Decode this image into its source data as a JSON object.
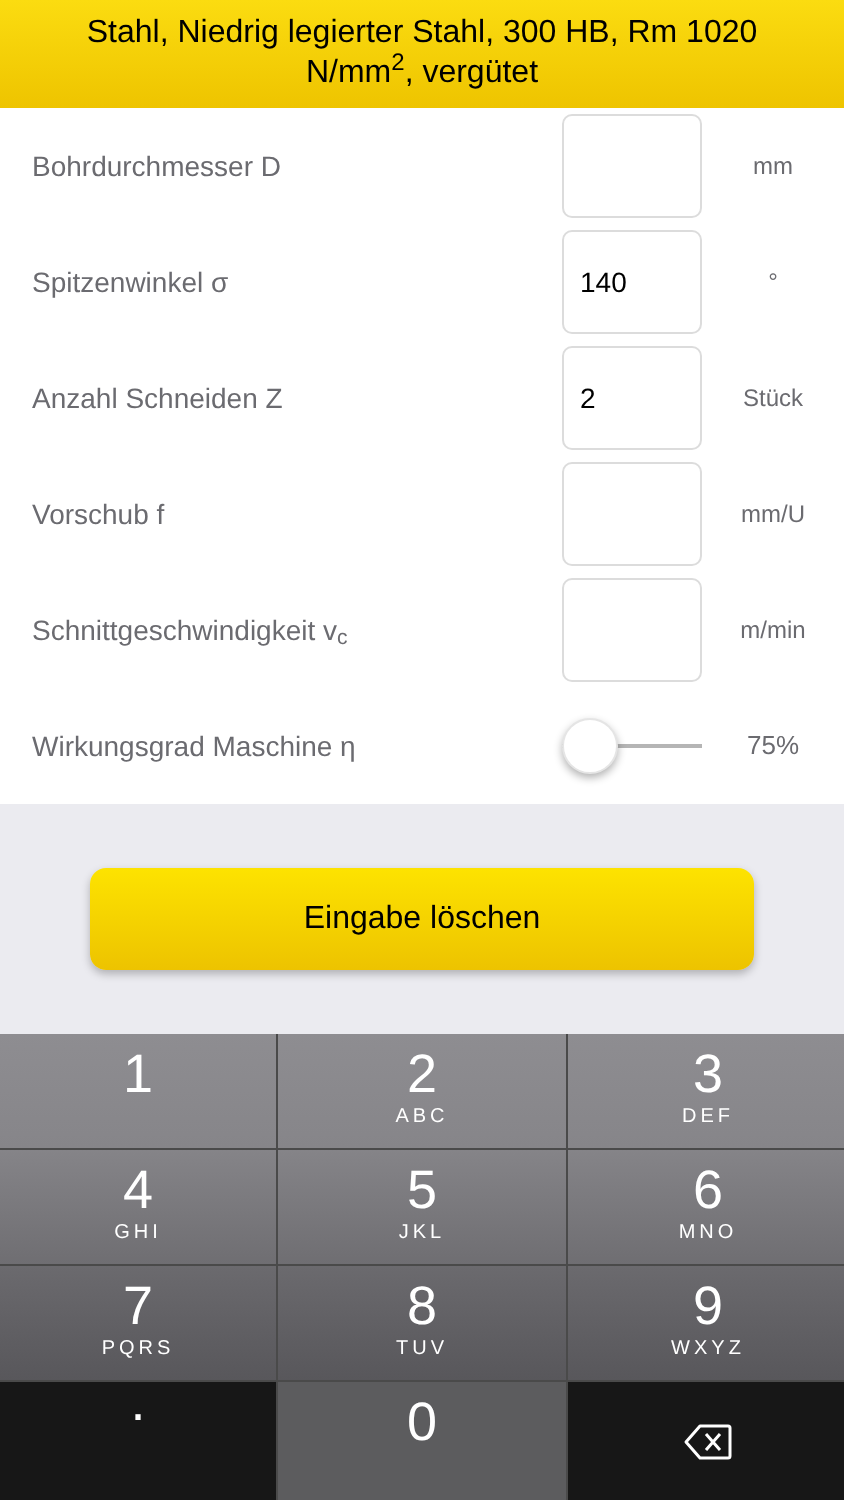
{
  "header": {
    "title": "Stahl, Niedrig legierter Stahl, 300 HB, Rm 1020 N/mm$^{2}$, vergütet"
  },
  "rows": [
    {
      "kind": "input",
      "label": "Bohrdurchmesser D",
      "unit": "mm"
    },
    {
      "kind": "input",
      "label": "Spitzenwinkel σ",
      "value": "140",
      "unit": "°"
    },
    {
      "kind": "input",
      "label": "Anzahl Schneiden Z",
      "value": "2",
      "unit": "Stück"
    },
    {
      "kind": "input",
      "label": "Vorschub f",
      "unit": "mm/U"
    },
    {
      "kind": "input",
      "label": "Schnittgeschwindigkeit v$_{c}$",
      "unit": "m/min"
    },
    {
      "kind": "slider",
      "label": "Wirkungsgrad Maschine η",
      "level": 0,
      "reading": "75%"
    }
  ],
  "clear_button": {
    "label": "Eingabe löschen"
  },
  "keypad": [
    {
      "kind": "digit",
      "digit": "1"
    },
    {
      "kind": "digit",
      "digit": "2",
      "letters": "ABC"
    },
    {
      "kind": "digit",
      "digit": "3",
      "letters": "DEF"
    },
    {
      "kind": "digit",
      "digit": "4",
      "letters": "GHI"
    },
    {
      "kind": "digit",
      "digit": "5",
      "letters": "JKL"
    },
    {
      "kind": "digit",
      "digit": "6",
      "letters": "MNO"
    },
    {
      "kind": "digit",
      "digit": "7",
      "letters": "PQRS"
    },
    {
      "kind": "digit",
      "digit": "8",
      "letters": "TUV"
    },
    {
      "kind": "digit",
      "digit": "9",
      "letters": "WXYZ"
    },
    {
      "kind": "dot",
      "digit": "."
    },
    {
      "kind": "digit",
      "digit": "0"
    },
    {
      "kind": "backspace"
    }
  ]
}
